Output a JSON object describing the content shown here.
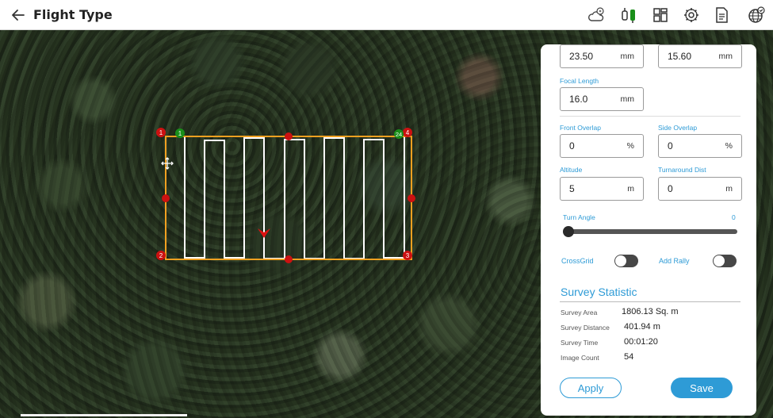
{
  "header": {
    "title": "Flight Type",
    "icons": [
      "back-arrow-icon",
      "weather-icon",
      "flight-controls-icon",
      "layout-icon",
      "settings-icon",
      "document-icon",
      "globe-icon"
    ]
  },
  "map": {
    "waypoint_labels": {
      "corner_1": "1",
      "corner_2": "2",
      "corner_3": "3",
      "corner_4": "4",
      "start": "1",
      "end": "24"
    },
    "colors": {
      "boundary": "#f0a020",
      "path": "#ffffff",
      "vertex": "#cc1111",
      "start": "#1a8f1a"
    }
  },
  "panel": {
    "sensor_width": {
      "value": "23.50",
      "unit": "mm"
    },
    "sensor_height": {
      "value": "15.60",
      "unit": "mm"
    },
    "focal_length": {
      "label": "Focal Length",
      "value": "16.0",
      "unit": "mm"
    },
    "front_overlap": {
      "label": "Front Overlap",
      "value": "0",
      "unit": "%"
    },
    "side_overlap": {
      "label": "Side Overlap",
      "value": "0",
      "unit": "%"
    },
    "altitude": {
      "label": "Altitude",
      "value": "5",
      "unit": "m"
    },
    "turnaround_dist": {
      "label": "Turnaround Dist",
      "value": "0",
      "unit": "m"
    },
    "turn_angle": {
      "label": "Turn Angle",
      "value": "0"
    },
    "crossgrid": {
      "label": "CrossGrid",
      "enabled": false
    },
    "add_rally": {
      "label": "Add Rally",
      "enabled": false
    },
    "statistics": {
      "title": "Survey Statistic",
      "rows": [
        {
          "label": "Survey Area",
          "value": "1806.13 Sq. m"
        },
        {
          "label": "Survey Distance",
          "value": "401.94 m"
        },
        {
          "label": "Survey Time",
          "value": "00:01:20"
        },
        {
          "label": "Image Count",
          "value": "54"
        }
      ]
    },
    "apply_label": "Apply",
    "save_label": "Save",
    "accent_color": "#2e9bd6"
  }
}
